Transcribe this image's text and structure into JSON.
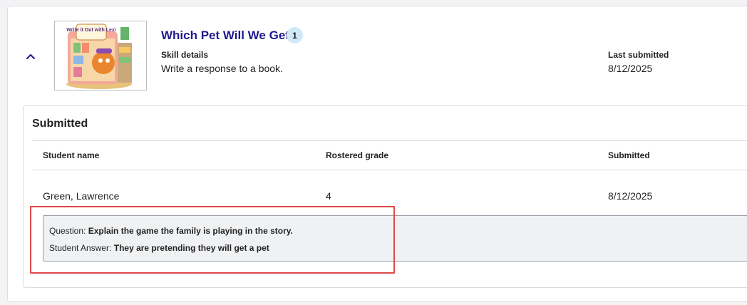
{
  "assignment": {
    "title": "Which Pet Will We Get?",
    "submission_count": "1",
    "skill_details_label": "Skill details",
    "skill_details_value": "Write a response to a book.",
    "last_submitted_label": "Last submitted",
    "last_submitted_value": "8/12/2025",
    "thumbnail_text": "Write it Out with Lexi"
  },
  "submitted_section": {
    "heading": "Submitted",
    "columns": [
      "Student name",
      "Rostered grade",
      "Submitted"
    ],
    "rows": [
      {
        "student_name": "Green, Lawrence",
        "grade": "4",
        "submitted": "8/12/2025"
      }
    ],
    "question_label": "Question: ",
    "question_text": "Explain the game the family is playing in the story.",
    "answer_label": "Student Answer: ",
    "answer_text": "They are pretending they will get a pet"
  },
  "colors": {
    "title": "#1f1a8c",
    "badge_bg": "#cfe9f7",
    "highlight": "#e04848"
  }
}
